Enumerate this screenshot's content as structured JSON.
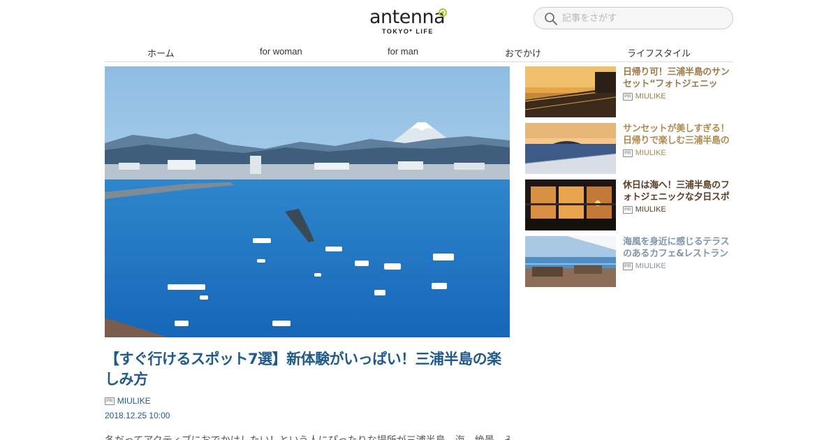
{
  "header": {
    "logo_text": "antenna",
    "logo_subtext": "TOKYO* LIFE",
    "search_placeholder": "記事をさがす"
  },
  "nav": {
    "items": [
      {
        "label": "ホーム"
      },
      {
        "label": "for woman"
      },
      {
        "label": "for man"
      },
      {
        "label": "おでかけ"
      },
      {
        "label": "ライフスタイル"
      }
    ]
  },
  "article": {
    "title": "【すぐ行けるスポット7選】新体験がいっぱい！三浦半島の楽しみ方",
    "pr_label": "PR",
    "author": "MIULIKE",
    "date": "2018.12.25 10:00",
    "body_preview": "冬だってアクティブにおでかけしたい！という人にぴったりな場所が三浦半島。海、絶景、そ"
  },
  "sidebar": {
    "items": [
      {
        "title": "日帰り可！三浦半島のサンセット“フォトジェニッ",
        "pr_label": "PR",
        "author": "MIULIKE",
        "color": "#9c7a45"
      },
      {
        "title": "サンセットが美しすぎる！日帰りで楽しむ三浦半島の",
        "pr_label": "PR",
        "author": "MIULIKE",
        "color": "#b08a4e"
      },
      {
        "title": "休日は海へ！三浦半島のフォトジェニックな夕日スポ",
        "pr_label": "PR",
        "author": "MIULIKE",
        "color": "#5a3e22"
      },
      {
        "title": "海風を身近に感じるテラスのあるカフェ&レストラン",
        "pr_label": "PR",
        "author": "MIULIKE",
        "color": "#7f96a8"
      }
    ]
  },
  "colors": {
    "title_blue": "#1e5a8e",
    "logo_accent": "#a9c92a"
  }
}
